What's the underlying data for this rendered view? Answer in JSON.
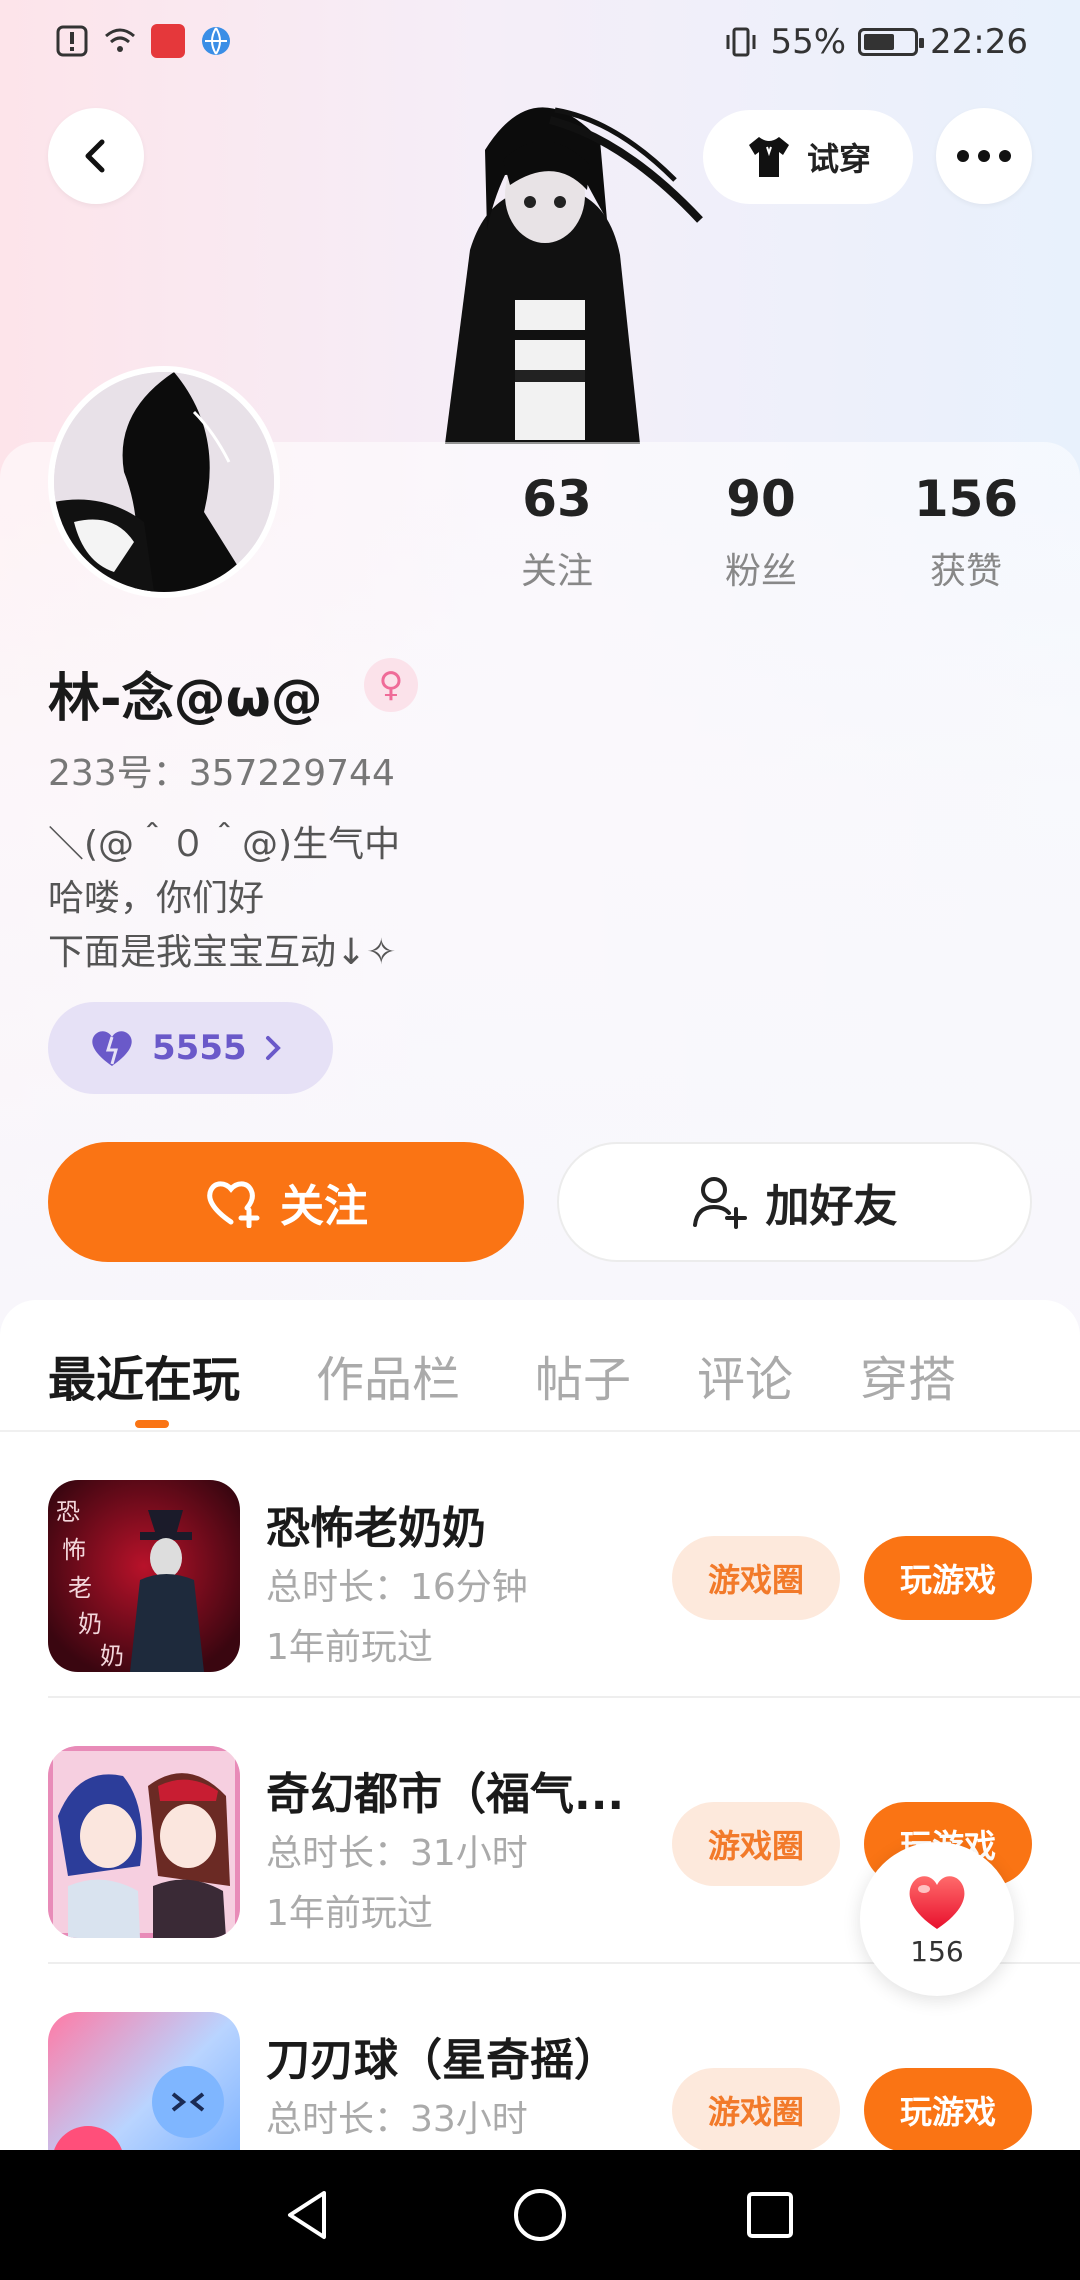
{
  "status_bar": {
    "battery": "55%",
    "time": "22:26"
  },
  "top_nav": {
    "try_on_label": "试穿"
  },
  "stats": [
    {
      "value": "63",
      "label": "关注"
    },
    {
      "value": "90",
      "label": "粉丝"
    },
    {
      "value": "156",
      "label": "获赞"
    }
  ],
  "profile": {
    "nickname": "林-念@ω@",
    "gender_symbol": "♀",
    "uid": "233号：357229744",
    "bio": [
      "＼(@＾０＾@)生气中",
      "哈喽，你们好",
      "下面是我宝宝互动↓✧"
    ],
    "heart_count": "5555"
  },
  "actions": {
    "follow_label": "关注",
    "add_friend_label": "加好友"
  },
  "tabs": [
    "最近在玩",
    "作品栏",
    "帖子",
    "评论",
    "穿搭"
  ],
  "games": [
    {
      "title": "恐怖老奶奶",
      "duration": "总时长：16分钟",
      "last_played": "1年前玩过",
      "circle_label": "游戏圈",
      "play_label": "玩游戏",
      "icon_text": "恐怖老奶奶"
    },
    {
      "title": "奇幻都市（福气...",
      "duration": "总时长：31小时",
      "last_played": "1年前玩过",
      "circle_label": "游戏圈",
      "play_label": "玩游戏"
    },
    {
      "title": "刀刃球（星奇摇）",
      "duration": "总时长：33小时",
      "last_played": "",
      "circle_label": "游戏圈",
      "play_label": "玩游戏"
    }
  ],
  "like_float": {
    "count": "156"
  },
  "colors": {
    "accent": "#fa7414",
    "heart_chip": "#6a59c9"
  }
}
